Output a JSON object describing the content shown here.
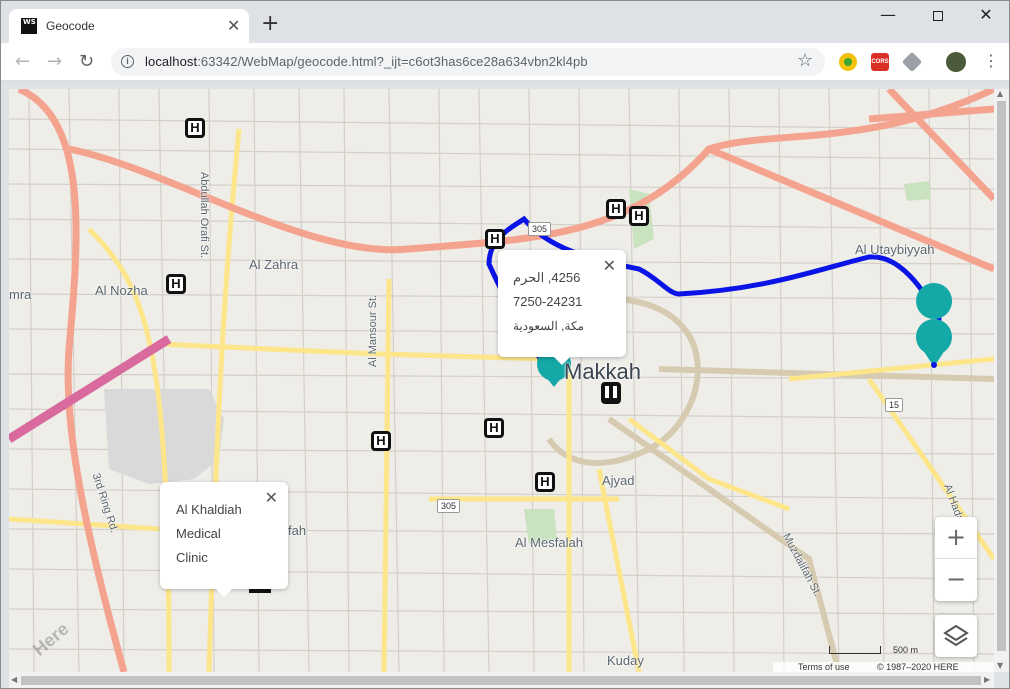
{
  "browser": {
    "tab_title": "Geocode",
    "tab_icon_text": "WS",
    "new_tab": "+",
    "tab_close": "✕",
    "url_host": "localhost",
    "url_rest": ":63342/WebMap/geocode.html?_ijt=c6ot3has6ce28a634vbn2kl4pb",
    "ext_cors_label": "CORS",
    "icons": [
      "back-arrow-icon",
      "forward-arrow-icon",
      "reload-icon",
      "info-icon",
      "star-icon",
      "kebab-menu-icon"
    ]
  },
  "map": {
    "labels": {
      "al_zahra": "Al Zahra",
      "al_nozha": "Al Nozha",
      "mra": "mra",
      "al_utaybiyyah": "Al Utaybiyyah",
      "makkah": "Makkah",
      "ajyad": "Ajyad",
      "al_mesfalah": "Al Mesfalah",
      "kuday": "Kuday",
      "abdullah_st": "Abdullah Orafi St.",
      "al_mansour_st": "Al Mansour St.",
      "third_ring": "3rd Ring Rd.",
      "muzdalifah_st": "Muzdalifah St.",
      "al_hada": "Al Hada",
      "fah": "fah"
    },
    "shields": {
      "s305a": "305",
      "s305b": "305",
      "s15": "15"
    },
    "popup_address": {
      "line1": "4256, الحرم",
      "line2": "7250-24231",
      "line3": "مكة, السعودية"
    },
    "popup_clinic": {
      "line1": "Al Khaldiah",
      "line2": "Medical",
      "line3": "Clinic"
    },
    "close_glyph": "✕",
    "hospital_glyph": "H",
    "zoom_in": "+",
    "zoom_out": "−",
    "scale_label": "500 m",
    "terms": "Terms of use",
    "copyright": "© 1987–2020 HERE",
    "here_logo": "Here",
    "route_color": "#0a14e6",
    "marker_color": "#14a8a6"
  }
}
